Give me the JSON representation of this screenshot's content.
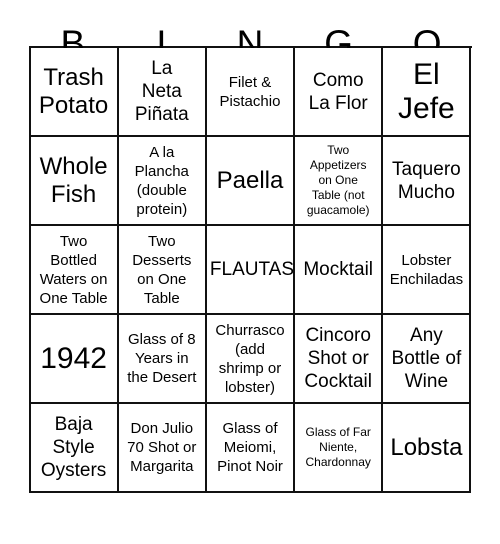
{
  "card": {
    "headers": [
      "B",
      "I",
      "N",
      "G",
      "O"
    ],
    "rows": [
      [
        {
          "text": "Trash\nPotato",
          "size": "lg"
        },
        {
          "text": "La\nNeta\nPiñata",
          "size": "md"
        },
        {
          "text": "Filet &\nPistachio",
          "size": "sm"
        },
        {
          "text": "Como\nLa Flor",
          "size": "md"
        },
        {
          "text": "El\nJefe",
          "size": "xl"
        }
      ],
      [
        {
          "text": "Whole\nFish",
          "size": "lg"
        },
        {
          "text": "A la\nPlancha\n(double\nprotein)",
          "size": "sm"
        },
        {
          "text": "Paella",
          "size": "lg"
        },
        {
          "text": "Two\nAppetizers\non One\nTable (not\nguacamole)",
          "size": "xs"
        },
        {
          "text": "Taquero\nMucho",
          "size": "md"
        }
      ],
      [
        {
          "text": "Two\nBottled\nWaters on\nOne Table",
          "size": "sm"
        },
        {
          "text": "Two\nDesserts\non One\nTable",
          "size": "sm"
        },
        {
          "text": "FLAUTAS!",
          "size": "md"
        },
        {
          "text": "Mocktail",
          "size": "md"
        },
        {
          "text": "Lobster\nEnchiladas",
          "size": "sm"
        }
      ],
      [
        {
          "text": "1942",
          "size": "xl"
        },
        {
          "text": "Glass of 8\nYears in\nthe Desert",
          "size": "sm"
        },
        {
          "text": "Churrasco\n(add\nshrimp or\nlobster)",
          "size": "sm"
        },
        {
          "text": "Cincoro\nShot or\nCocktail",
          "size": "md"
        },
        {
          "text": "Any\nBottle of\nWine",
          "size": "md"
        }
      ],
      [
        {
          "text": "Baja\nStyle\nOysters",
          "size": "md"
        },
        {
          "text": "Don Julio\n70 Shot or\nMargarita",
          "size": "sm"
        },
        {
          "text": "Glass of\nMeiomi,\nPinot Noir",
          "size": "sm"
        },
        {
          "text": "Glass of Far\nNiente,\nChardonnay",
          "size": "xs"
        },
        {
          "text": "Lobsta",
          "size": "lg"
        }
      ]
    ]
  }
}
